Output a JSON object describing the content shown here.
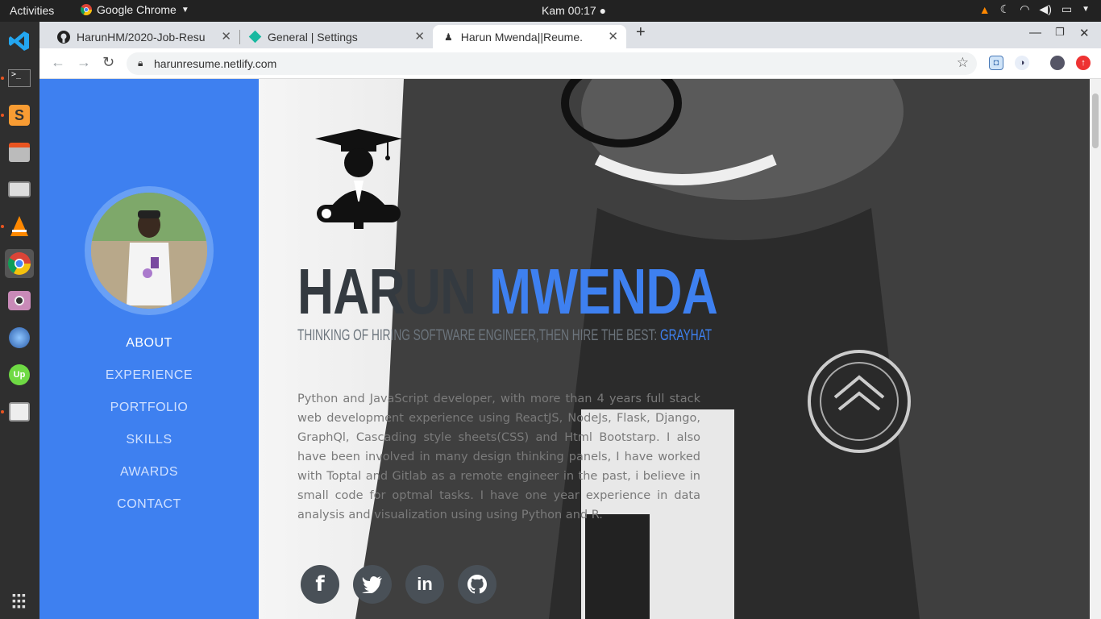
{
  "system": {
    "activities": "Activities",
    "app_name": "Google Chrome",
    "clock": "Kam 00:17"
  },
  "dock": {
    "items": [
      "vscode-icon",
      "terminal-icon",
      "sublime-icon",
      "files-icon",
      "screenshot-icon",
      "vlc-icon",
      "chrome-icon",
      "camera-icon",
      "browser-icon",
      "upwork-icon",
      "image-viewer-icon"
    ],
    "show_apps": "apps-grid-icon"
  },
  "browser": {
    "tabs": [
      {
        "title": "HarunHM/2020-Job-Resu",
        "icon": "github-icon"
      },
      {
        "title": "General | Settings",
        "icon": "diamond-icon"
      },
      {
        "title": "Harun Mwenda||Reume.",
        "icon": "graduate-icon"
      }
    ],
    "new_tab": "+",
    "url": "harunresume.netlify.com"
  },
  "sidebar": {
    "items": [
      {
        "label": "ABOUT"
      },
      {
        "label": "EXPERIENCE"
      },
      {
        "label": "PORTFOLIO"
      },
      {
        "label": "SKILLS"
      },
      {
        "label": "AWARDS"
      },
      {
        "label": "CONTACT"
      }
    ]
  },
  "hero": {
    "first_name": "HARUN",
    "last_name": "MWENDA",
    "tagline": "THINKING OF HIRING SOFTWARE ENGINEER,THEN HIRE THE BEST: ",
    "tagline_highlight": "GRAYHAT",
    "bio": "Python and JavaScript developer, with more than 4 years full stack web development experience using ReactJS, NodeJs, Flask, Django, GraphQl, Cascading style sheets(CSS) and Html Bootstarp. I also have been involved in many design thinking panels, I have worked with Toptal and Gitlab as a remote engineer in the past, i believe in small code for optmal tasks. I have one year experience in data analysis and visualization using using Python and R."
  },
  "social": {
    "facebook": "f",
    "twitter": "twitter-icon",
    "linkedin": "in",
    "github": "github-icon"
  },
  "colors": {
    "accent": "#3e80f0",
    "sidebar": "#3e80f0",
    "dark": "#343a40"
  }
}
